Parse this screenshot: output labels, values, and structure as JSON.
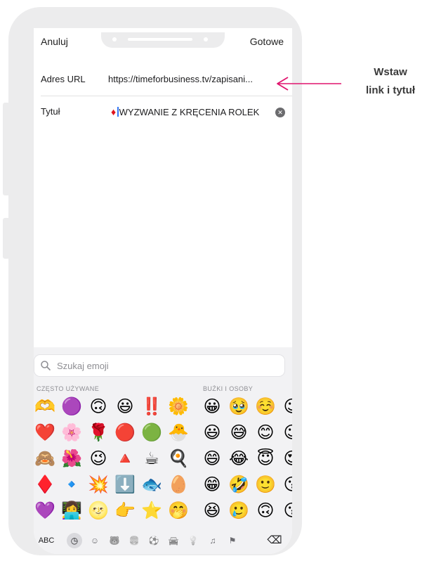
{
  "nav": {
    "cancel": "Anuluj",
    "done": "Gotowe"
  },
  "form": {
    "url_label": "Adres URL",
    "url_value": "https://timeforbusiness.tv/zapisani...",
    "title_label": "Tytuł",
    "title_prefix": "♦",
    "title_value": "WYZWANIE Z KRĘCENIA ROLEK"
  },
  "keyboard": {
    "search_placeholder": "Szukaj emoji",
    "section_frequent": "CZĘSTO UŻYWANE",
    "section_faces": "BUŹKI I OSOBY",
    "frequent": [
      [
        "🫶",
        "🟣",
        "🙃",
        "😃",
        "‼️",
        "🌼"
      ],
      [
        "❤️",
        "🌸",
        "🌹",
        "🔴",
        "🟢",
        "🐣"
      ],
      [
        "🙈",
        "🌺",
        "😉",
        "🔺",
        "☕",
        "🍳"
      ],
      [
        "♦️",
        "🔹",
        "💥",
        "⬇️",
        "🐟",
        "🥚"
      ],
      [
        "💜",
        "👩‍💻",
        "🌝",
        "👉",
        "⭐",
        "🤭"
      ]
    ],
    "faces": [
      [
        "😀",
        "🥹",
        "☺️",
        "😉"
      ],
      [
        "😃",
        "😅",
        "😊",
        "😉"
      ],
      [
        "😄",
        "😂",
        "😇",
        "😍"
      ],
      [
        "😁",
        "🤣",
        "🙂",
        "😘"
      ],
      [
        "😆",
        "🥲",
        "🙃",
        "😗"
      ]
    ],
    "categories": {
      "abc": "ABC",
      "recent": "◷",
      "smileys": "☺",
      "animals": "🐻",
      "food": "🍔",
      "activity": "⚽",
      "travel": "🚘",
      "objects": "💡",
      "symbols": "♫",
      "flags": "⚑",
      "delete": "⌫"
    }
  },
  "callout": {
    "line1": "Wstaw",
    "line2": "link i tytuł"
  },
  "colors": {
    "accent": "#e0146e",
    "diamond": "#e0141c",
    "frame": "#ececed"
  }
}
